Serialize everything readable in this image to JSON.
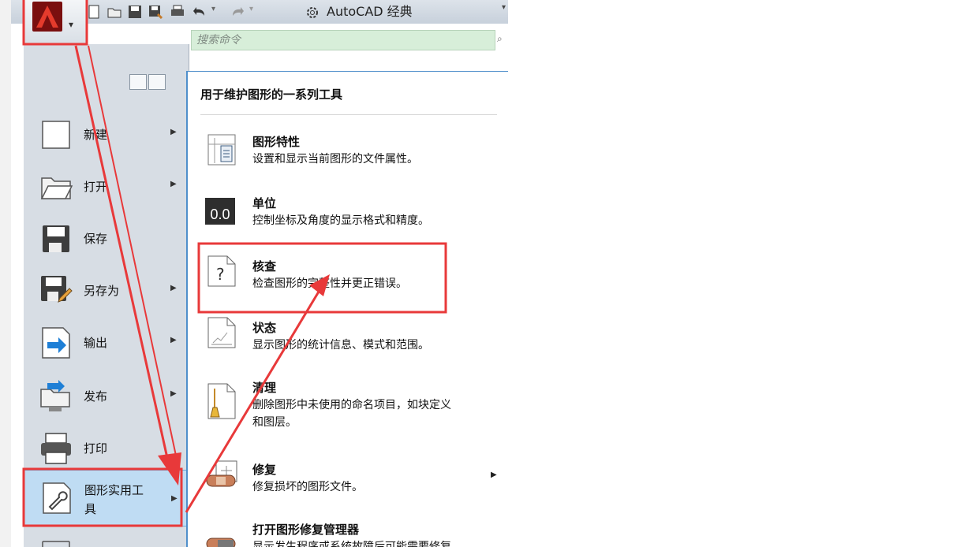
{
  "titlebar": {
    "workspace_label": "AutoCAD 经典"
  },
  "search": {
    "placeholder": "搜索命令"
  },
  "left_menu": {
    "items": [
      {
        "label": "新建"
      },
      {
        "label": "打开"
      },
      {
        "label": "保存"
      },
      {
        "label": "另存为"
      },
      {
        "label": "输出"
      },
      {
        "label": "发布"
      },
      {
        "label": "打印"
      },
      {
        "label_line1": "图形实用工",
        "label_line2": "具"
      }
    ]
  },
  "submenu": {
    "title": "用于维护图形的一系列工具",
    "items": [
      {
        "title": "图形特性",
        "desc": "设置和显示当前图形的文件属性。"
      },
      {
        "title": "单位",
        "desc": "控制坐标及角度的显示格式和精度。",
        "icon_text": "0.0"
      },
      {
        "title": "核查",
        "desc": "检查图形的完整性并更正错误。"
      },
      {
        "title": "状态",
        "desc": "显示图形的统计信息、模式和范围。"
      },
      {
        "title": "清理",
        "desc_line1": "删除图形中未使用的命名项目，如块定义",
        "desc_line2": "和图层。"
      },
      {
        "title": "修复",
        "desc": "修复损坏的图形文件。"
      },
      {
        "title": "打开图形修复管理器",
        "desc": "显示发生程序或系统故障后可能需要修复"
      }
    ]
  },
  "annotation_colors": {
    "highlight": "#e8393a"
  }
}
